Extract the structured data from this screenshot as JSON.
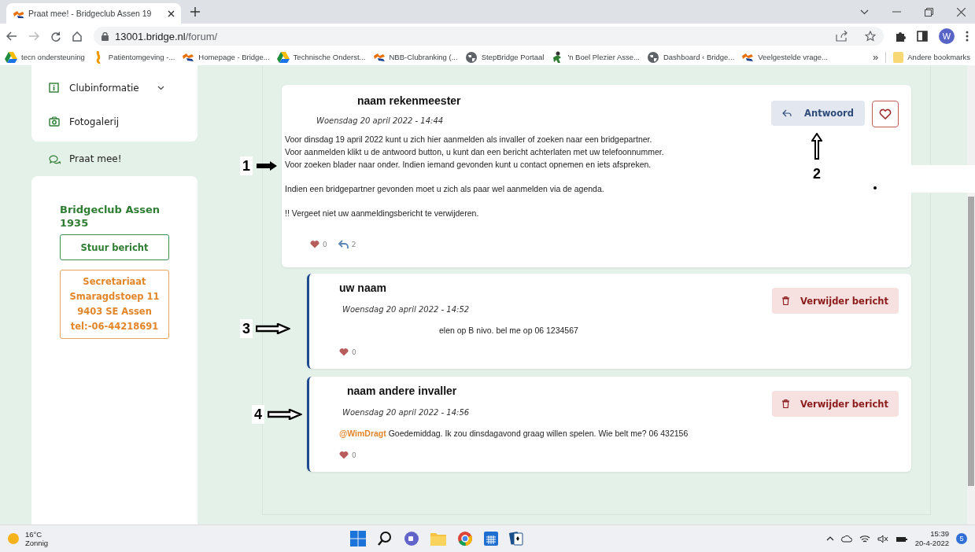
{
  "browser": {
    "tab_title": "Praat mee! - Bridgeclub Assen 19",
    "url_host": "13001.bridge.nl",
    "url_path": "/forum/",
    "profile": "W",
    "bookmarks": [
      {
        "label": "tecn ondersteuning",
        "kind": "drive"
      },
      {
        "label": "Patiëntomgeving -...",
        "kind": "ribbon"
      },
      {
        "label": "Homepage - Bridge...",
        "kind": "logo"
      },
      {
        "label": "Technische Onderst...",
        "kind": "drive"
      },
      {
        "label": "NBB-Clubranking (...",
        "kind": "logo"
      },
      {
        "label": "StepBridge Portaal",
        "kind": "globe"
      },
      {
        "label": "'n Boel Plezier Asse...",
        "kind": "figure"
      },
      {
        "label": "Dashboard ‹ Bridge...",
        "kind": "globe"
      },
      {
        "label": "Veelgestelde vrage...",
        "kind": "logo"
      }
    ],
    "more": "»",
    "other_bookmarks": "Andere bookmarks"
  },
  "sidebar": {
    "menu": [
      {
        "label": "Clubinformatie",
        "kind": "info",
        "has_submenu": true,
        "selected": false
      },
      {
        "label": "Fotogalerij",
        "kind": "camera",
        "has_submenu": false,
        "selected": false
      },
      {
        "label": "Praat mee!",
        "kind": "chat",
        "has_submenu": false,
        "selected": true
      }
    ],
    "club": {
      "name": "Bridgeclub Assen 1935",
      "button": "Stuur bericht",
      "address": [
        "Secretariaat",
        "Smaragdstoep 11",
        "9403 SE Assen",
        "tel:-06-44218691"
      ]
    }
  },
  "posts": [
    {
      "kind": "topic",
      "author": "naam rekenmeester",
      "date": "Woensdag 20 april 2022 - 14:44",
      "paragraphs": [
        [
          "Voor dinsdag 19 april 2022 kunt u zich hier aanmelden als invaller of zoeken naar een bridgepartner.",
          "Voor aanmelden klikt u de antwoord button, u kunt dan een bericht achterlaten met uw telefoonnummer.",
          "Voor zoeken blader naar onder. Indien iemand gevonden kunt u contact opnemen en iets afspreken."
        ],
        [
          "Indien een bridgepartner gevonden moet u zich als paar wel aanmelden via de agenda."
        ],
        [
          "!! Vergeet niet uw aanmeldingsbericht te verwijderen."
        ]
      ],
      "likes": "0",
      "replies": "2",
      "action": "Antwoord"
    },
    {
      "kind": "reply",
      "author": "uw naam",
      "date": "Woensdag 20 april 2022 - 14:52",
      "paragraphs": [
        [
          "elen op B nivo. bel me op 06 1234567"
        ]
      ],
      "likes": "0",
      "action": "Verwijder bericht"
    },
    {
      "kind": "reply",
      "author": "naam andere invaller",
      "date": "Woensdag 20 april 2022 - 14:56",
      "mention": "@WimDragt",
      "paragraphs": [
        [
          "Goedemiddag. Ik zou dinsdagavond graag willen spelen. Wie belt me? 06 432156"
        ]
      ],
      "likes": "0",
      "action": "Verwijder bericht"
    }
  ],
  "annotations": [
    {
      "label": "1",
      "kind": "right"
    },
    {
      "label": "2",
      "kind": "up"
    },
    {
      "label": "3",
      "kind": "right"
    },
    {
      "label": "4",
      "kind": "right"
    }
  ],
  "taskbar": {
    "temperature": "16°C",
    "weather": "Zonnig",
    "time": "15:39",
    "date": "20-4-2022",
    "notifications": "5"
  }
}
